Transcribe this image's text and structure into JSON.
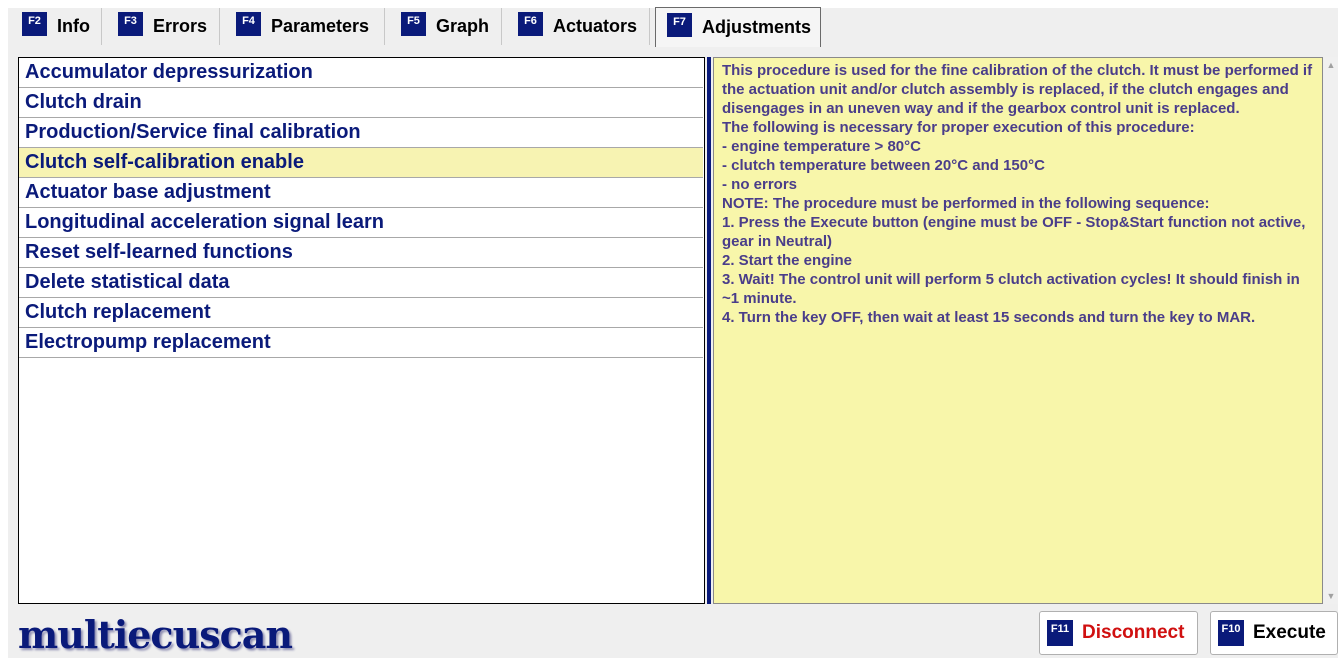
{
  "tabs": [
    {
      "key": "F2",
      "label": "Info"
    },
    {
      "key": "F3",
      "label": "Errors"
    },
    {
      "key": "F4",
      "label": "Parameters"
    },
    {
      "key": "F5",
      "label": "Graph"
    },
    {
      "key": "F6",
      "label": "Actuators"
    },
    {
      "key": "F7",
      "label": "Adjustments",
      "active": true
    }
  ],
  "procedures": {
    "items": [
      "Accumulator depressurization",
      "Clutch drain",
      "Production/Service final calibration",
      "Clutch self-calibration enable",
      "Actuator base adjustment",
      "Longitudinal acceleration signal learn",
      "Reset self-learned functions",
      "Delete statistical data",
      "Clutch replacement",
      "Electropump replacement"
    ],
    "selected_index": 3
  },
  "description": {
    "lines": [
      "This procedure is used for the fine calibration of the clutch. It must be performed if the actuation unit and/or clutch assembly is replaced, if the clutch engages and disengages in an uneven way and if the gearbox control unit is replaced.",
      "The following is necessary for proper execution of this procedure:",
      "- engine temperature > 80°C",
      "- clutch temperature between 20°C and 150°C",
      "- no errors",
      "NOTE:  The procedure must be performed in the following sequence:",
      "1. Press the Execute button (engine must be OFF - Stop&Start function not active, gear in Neutral)",
      "2. Start the engine",
      "3. Wait! The control unit will perform 5 clutch activation cycles! It should finish in ~1 minute.",
      "4. Turn the key OFF, then wait at least 15 seconds and turn the key to MAR."
    ]
  },
  "footer": {
    "logo": "multiecuscan",
    "disconnect": {
      "key": "F11",
      "label": "Disconnect"
    },
    "execute": {
      "key": "F10",
      "label": "Execute"
    }
  },
  "colors": {
    "brand": "#0a1a7a",
    "selected_row": "#f7f3b2",
    "description_bg": "#f8f6aa",
    "disconnect_text": "#d01010"
  },
  "icons": [
    "scroll-up-arrow-icon",
    "scroll-down-arrow-icon"
  ]
}
